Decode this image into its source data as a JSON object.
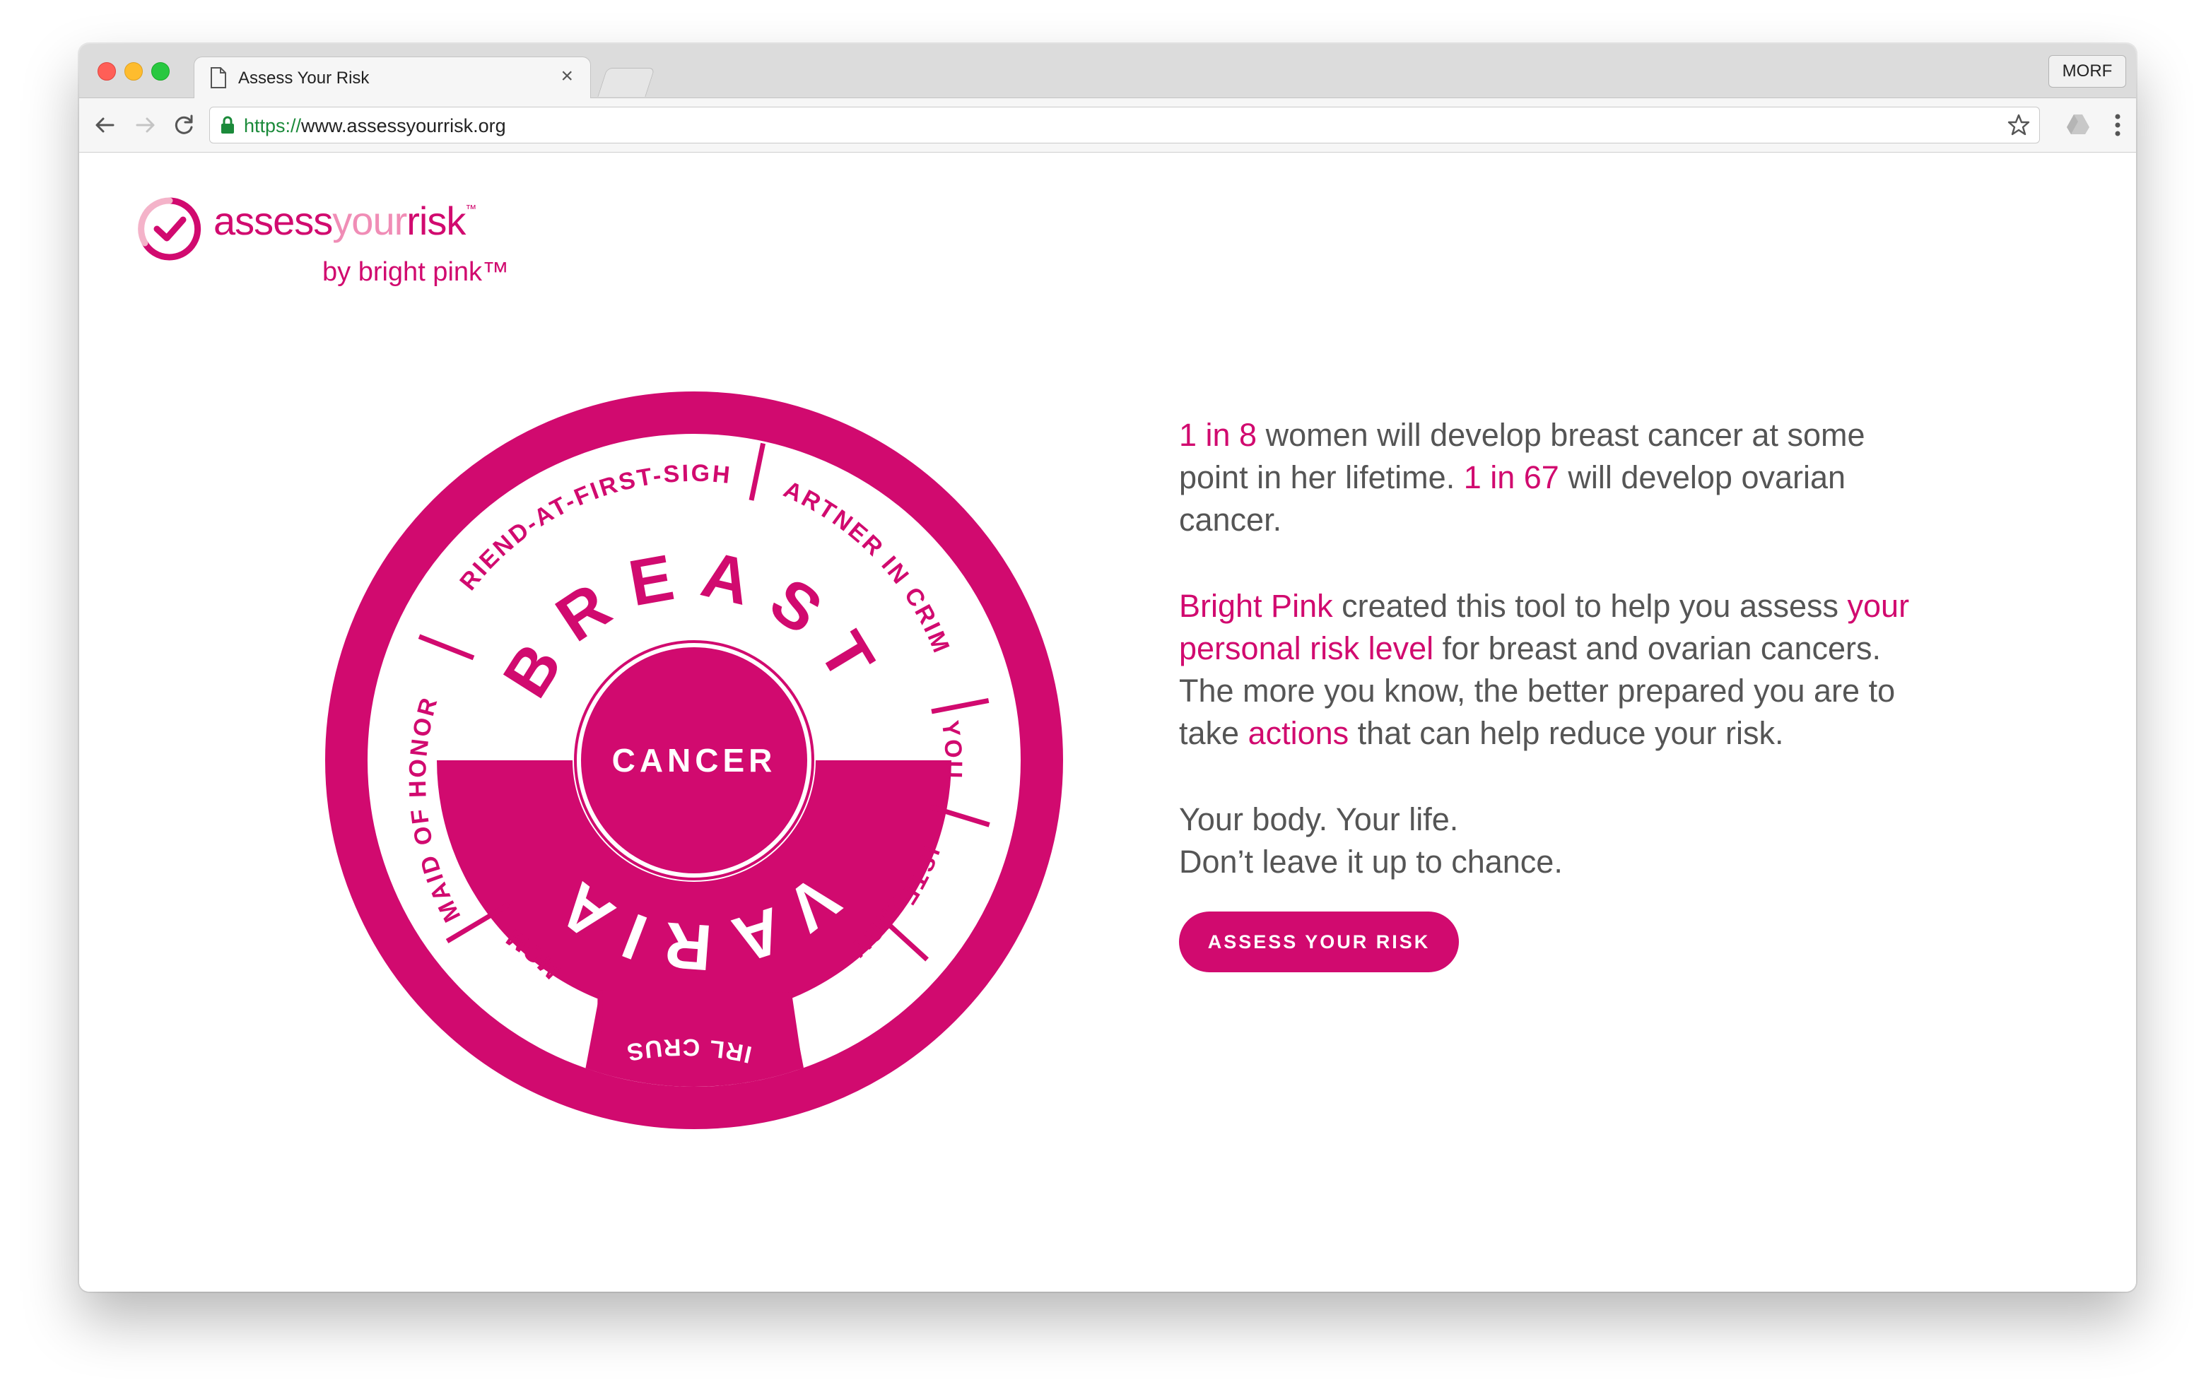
{
  "browser": {
    "tab_title": "Assess Your Risk",
    "tab_close": "×",
    "profile_button": "MORF",
    "url_scheme": "https://",
    "url_host": "www.assessyourrisk.org"
  },
  "logo": {
    "word_assess": "assess",
    "word_your": "your",
    "word_risk": "risk",
    "trademark": "™",
    "byline": "by bright pink™"
  },
  "wheel": {
    "top_word": "BREAST",
    "center_word": "CANCER",
    "bottom_word": "OVARIAN",
    "segments": [
      "FRIEND-AT-FIRST-SIGHT",
      "PARTNER IN CRIME",
      "YOU",
      "SISTER",
      "AUNT",
      "GIRL CRUSH",
      "MOM",
      "MAID OF HONOR"
    ]
  },
  "copy": {
    "p1": {
      "a": "1 in 8",
      "b": " women will develop breast cancer at some point in her lifetime. ",
      "c": "1 in 67",
      "d": " will develop ovarian cancer."
    },
    "p2": {
      "a": "Bright Pink",
      "b": " created this tool to help you assess ",
      "c": "your personal risk level",
      "d": " for breast and ovarian cancers. The more you know, the better prepared you are to take ",
      "e": "actions",
      "f": " that can help reduce your risk."
    },
    "tagline1": "Your body. Your life.",
    "tagline2": "Don’t leave it up to chance.",
    "cta": "ASSESS YOUR RISK"
  },
  "colors": {
    "brand_pink": "#d10a6f",
    "light_pink": "#f08db6",
    "body_text": "#555555"
  },
  "icons": [
    "document-icon",
    "close-icon",
    "back-arrow-icon",
    "forward-arrow-icon",
    "reload-icon",
    "lock-icon",
    "star-icon",
    "drive-icon",
    "menu-icon",
    "check-circle-icon"
  ]
}
